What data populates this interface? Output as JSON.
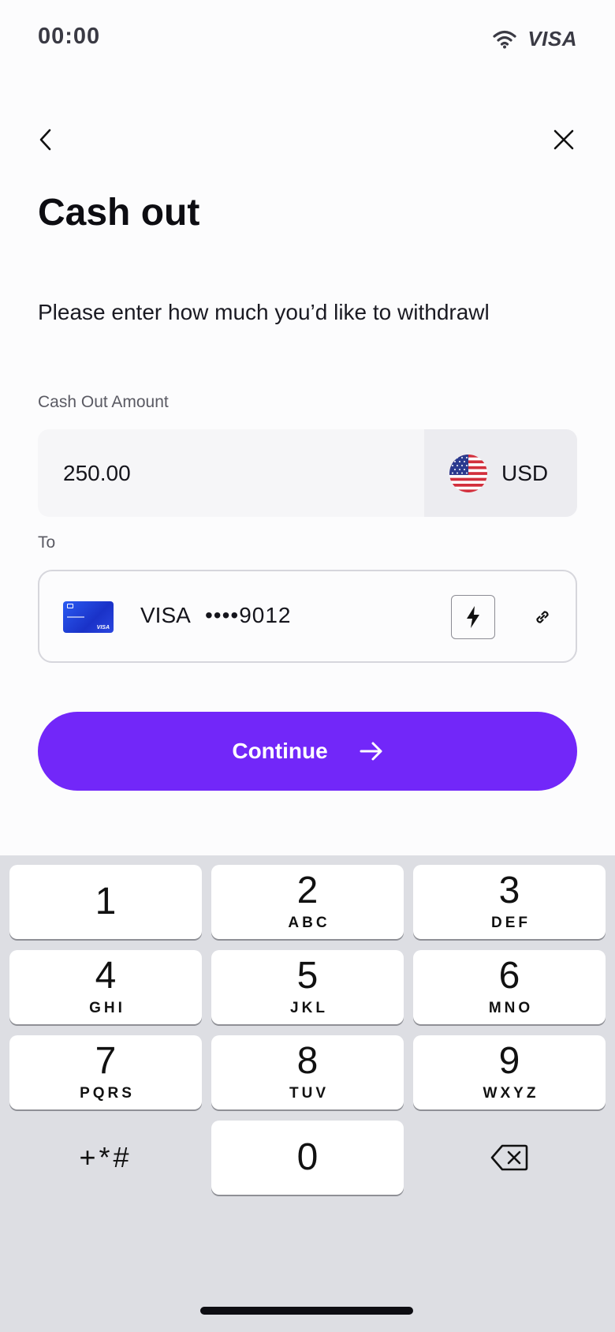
{
  "status_bar": {
    "time": "00:00",
    "carrier": "VISA"
  },
  "header": {
    "title": "Cash out"
  },
  "form": {
    "prompt": "Please enter how much you’d like to withdrawl",
    "amount_label": "Cash Out Amount",
    "amount_value": "250.00",
    "currency_code": "USD",
    "to_label": "To",
    "card_brand": "VISA",
    "card_number_masked": "••••9012",
    "card_thumb_brand": "VISA"
  },
  "actions": {
    "continue_label": "Continue"
  },
  "keypad": {
    "keys": [
      {
        "digit": "1",
        "letters": ""
      },
      {
        "digit": "2",
        "letters": "ABC"
      },
      {
        "digit": "3",
        "letters": "DEF"
      },
      {
        "digit": "4",
        "letters": "GHI"
      },
      {
        "digit": "5",
        "letters": "JKL"
      },
      {
        "digit": "6",
        "letters": "MNO"
      },
      {
        "digit": "7",
        "letters": "PQRS"
      },
      {
        "digit": "8",
        "letters": "TUV"
      },
      {
        "digit": "9",
        "letters": "WXYZ"
      },
      {
        "digit": "0",
        "letters": ""
      }
    ],
    "symbols_label": "+*#"
  },
  "colors": {
    "accent": "#7227f9",
    "keypad_bg": "#dddee3"
  }
}
